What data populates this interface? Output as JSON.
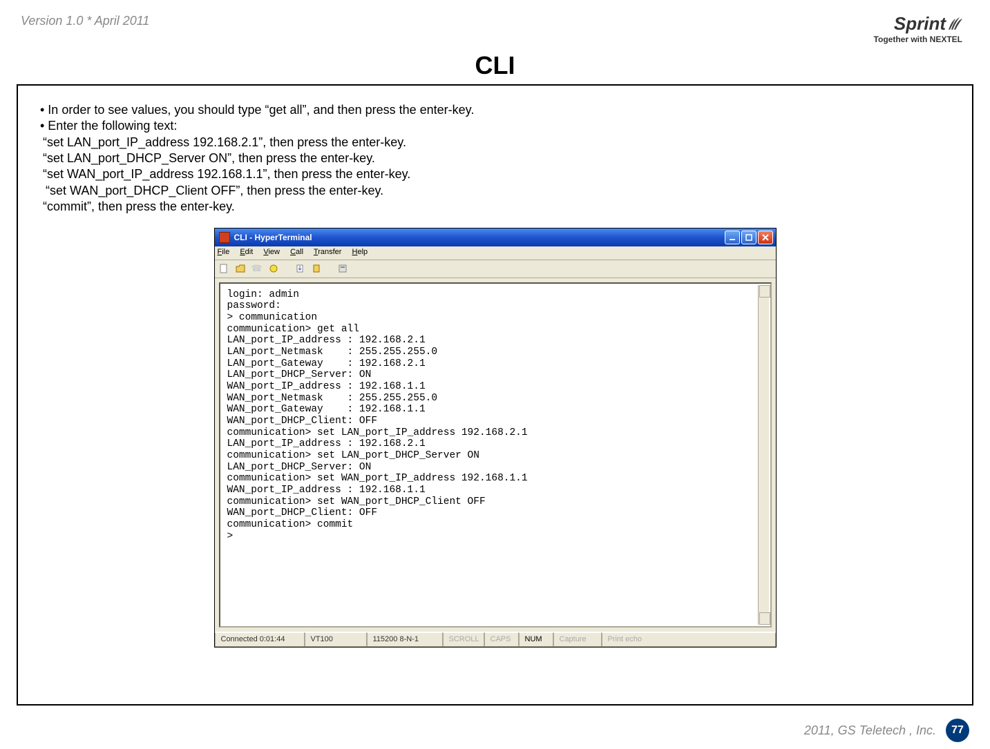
{
  "header": {
    "version": "Version 1.0 * April 2011",
    "brand_top": "Sprint",
    "brand_bottom": "Together with NEXTEL"
  },
  "title": "CLI",
  "instructions": {
    "b1": "• In order to see values, you should type “get all”, and then press the enter-key.",
    "b2": "• Enter the following text:",
    "c1": "“set LAN_port_IP_address 192.168.2.1”, then press the enter-key.",
    "c2": "“set LAN_port_DHCP_Server ON”, then press the enter-key.",
    "c3": "“set WAN_port_IP_address 192.168.1.1”, then press the enter-key.",
    "c4": " “set WAN_port_DHCP_Client OFF”, then press the enter-key.",
    "c5": "“commit”, then press the enter-key."
  },
  "hyperterminal": {
    "title": "CLI - HyperTerminal",
    "menu": {
      "file": "File",
      "edit": "Edit",
      "view": "View",
      "call": "Call",
      "transfer": "Transfer",
      "help": "Help"
    },
    "terminal_text": "login: admin\npassword:\n> communication\ncommunication> get all\nLAN_port_IP_address : 192.168.2.1\nLAN_port_Netmask    : 255.255.255.0\nLAN_port_Gateway    : 192.168.2.1\nLAN_port_DHCP_Server: ON\nWAN_port_IP_address : 192.168.1.1\nWAN_port_Netmask    : 255.255.255.0\nWAN_port_Gateway    : 192.168.1.1\nWAN_port_DHCP_Client: OFF\ncommunication> set LAN_port_IP_address 192.168.2.1\nLAN_port_IP_address : 192.168.2.1\ncommunication> set LAN_port_DHCP_Server ON\nLAN_port_DHCP_Server: ON\ncommunication> set WAN_port_IP_address 192.168.1.1\nWAN_port_IP_address : 192.168.1.1\ncommunication> set WAN_port_DHCP_Client OFF\nWAN_port_DHCP_Client: OFF\ncommunication> commit\n>",
    "status": {
      "connected": "Connected 0:01:44",
      "emulation": "VT100",
      "settings": "115200 8-N-1",
      "scroll": "SCROLL",
      "caps": "CAPS",
      "num": "NUM",
      "capture": "Capture",
      "printecho": "Print echo"
    }
  },
  "footer": {
    "copyright": "2011, GS Teletech , Inc.",
    "page_number": "77"
  }
}
